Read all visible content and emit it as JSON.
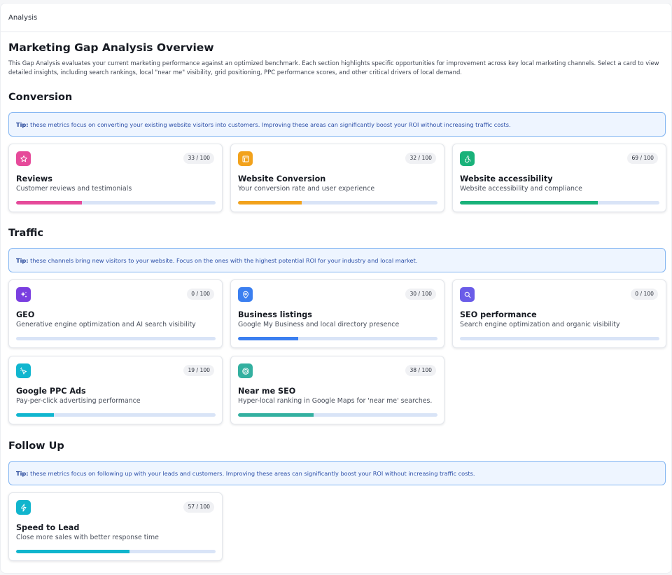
{
  "topbar": {
    "title": "Analysis"
  },
  "page": {
    "title": "Marketing Gap Analysis Overview",
    "description": "This Gap Analysis evaluates your current marketing performance against an optimized benchmark. Each section highlights specific opportunities for improvement across key local marketing channels. Select a card to view detailed insights, including search rankings, local \"near me\" visibility, grid positioning, PPC performance scores, and other critical drivers of local demand."
  },
  "sections": [
    {
      "title": "Conversion",
      "tip_label": "Tip:",
      "tip_text": " these metrics focus on converting your existing website visitors into customers. Improving these areas can significantly boost your ROI without increasing traffic costs.",
      "cards": [
        {
          "title": "Reviews",
          "subtitle": "Customer reviews and testimonials",
          "score": "33 / 100",
          "value": 33,
          "color": "#e64a9a",
          "icon": "star-icon"
        },
        {
          "title": "Website Conversion",
          "subtitle": "Your conversion rate and user experience",
          "score": "32 / 100",
          "value": 32,
          "color": "#f2a21c",
          "icon": "layout-icon"
        },
        {
          "title": "Website accessibility",
          "subtitle": "Website accessibility and compliance",
          "score": "69 / 100",
          "value": 69,
          "color": "#19b27a",
          "icon": "accessibility-icon"
        }
      ]
    },
    {
      "title": "Traffic",
      "tip_label": "Tip:",
      "tip_text": " these channels bring new visitors to your website. Focus on the ones with the highest potential ROI for your industry and local market.",
      "cards": [
        {
          "title": "GEO",
          "subtitle": "Generative engine optimization and AI search visibility",
          "score": "0 / 100",
          "value": 0,
          "color": "#7a3fe0",
          "icon": "sparkles-icon"
        },
        {
          "title": "Business listings",
          "subtitle": "Google My Business and local directory presence",
          "score": "30 / 100",
          "value": 30,
          "color": "#3b7ff0",
          "icon": "map-pin-icon"
        },
        {
          "title": "SEO performance",
          "subtitle": "Search engine optimization and organic visibility",
          "score": "0 / 100",
          "value": 0,
          "color": "#6a5ce8",
          "icon": "search-icon"
        },
        {
          "title": "Google PPC Ads",
          "subtitle": "Pay-per-click advertising performance",
          "score": "19 / 100",
          "value": 19,
          "color": "#10b6cf",
          "icon": "cursor-click-icon"
        },
        {
          "title": "Near me SEO",
          "subtitle": "Hyper-local ranking in Google Maps for 'near me' searches.",
          "score": "38 / 100",
          "value": 38,
          "color": "#33b0a0",
          "icon": "target-icon"
        }
      ]
    },
    {
      "title": "Follow Up",
      "tip_label": "Tip:",
      "tip_text": " these metrics focus on following up with your leads and customers. Improving these areas can significantly boost your ROI without increasing traffic costs.",
      "cards": [
        {
          "title": "Speed to Lead",
          "subtitle": "Close more sales with better response time",
          "score": "57 / 100",
          "value": 57,
          "color": "#11b5cd",
          "icon": "lightning-icon"
        }
      ]
    }
  ]
}
